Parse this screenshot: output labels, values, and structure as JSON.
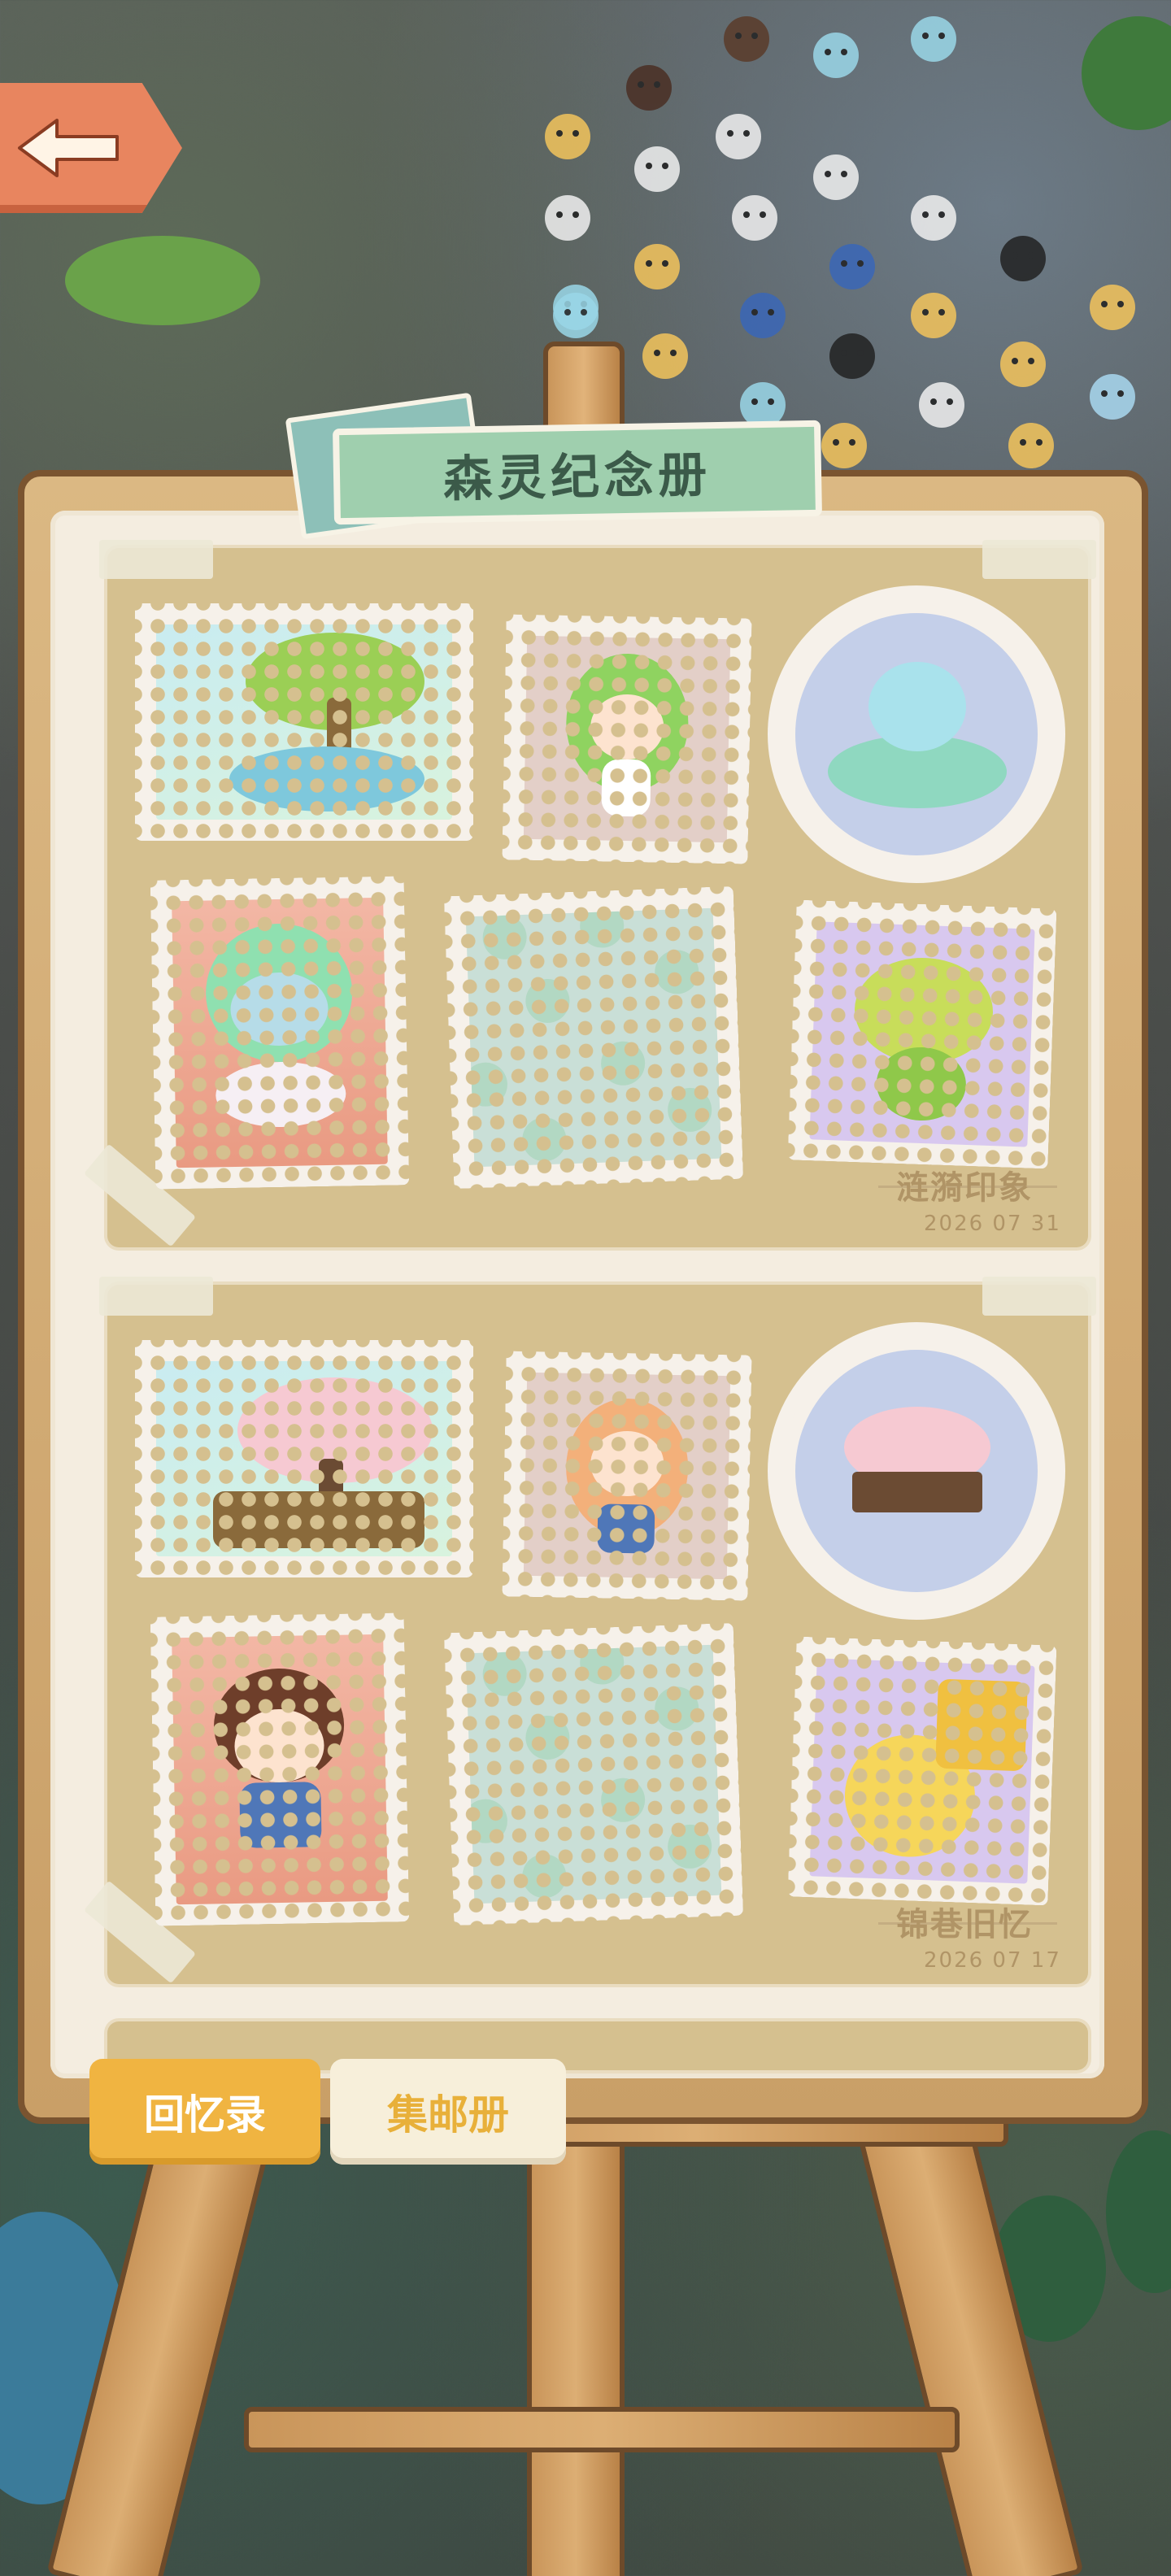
{
  "album_title": "森灵纪念册",
  "pages": [
    {
      "caption_title": "涟漪印象",
      "caption_date": "2026 07 31",
      "stamps": [
        {
          "name": "tree-swing-pond",
          "empty": false
        },
        {
          "name": "green-hair-girl",
          "empty": false
        },
        {
          "name": "fountain",
          "empty": false
        },
        {
          "name": "jelly-spirit",
          "empty": false
        },
        {
          "name": "empty-slot",
          "empty": true
        },
        {
          "name": "green-sprout-creature",
          "empty": false
        }
      ]
    },
    {
      "caption_title": "锦巷旧忆",
      "caption_date": "2026 07 17",
      "stamps": [
        {
          "name": "cherry-blossom-tree",
          "empty": false
        },
        {
          "name": "fox-girl-goggles",
          "empty": false
        },
        {
          "name": "blossom-fence",
          "empty": false
        },
        {
          "name": "cat-girl-bow",
          "empty": false
        },
        {
          "name": "empty-slot",
          "empty": true
        },
        {
          "name": "yellow-cat-toy",
          "empty": false
        }
      ]
    }
  ],
  "tabs": {
    "memoir": "回忆录",
    "stamp_book": "集邮册"
  },
  "colors": {
    "accent": "#f0b441",
    "title_tab": "#9fcfae",
    "back_button": "#e8855f"
  }
}
